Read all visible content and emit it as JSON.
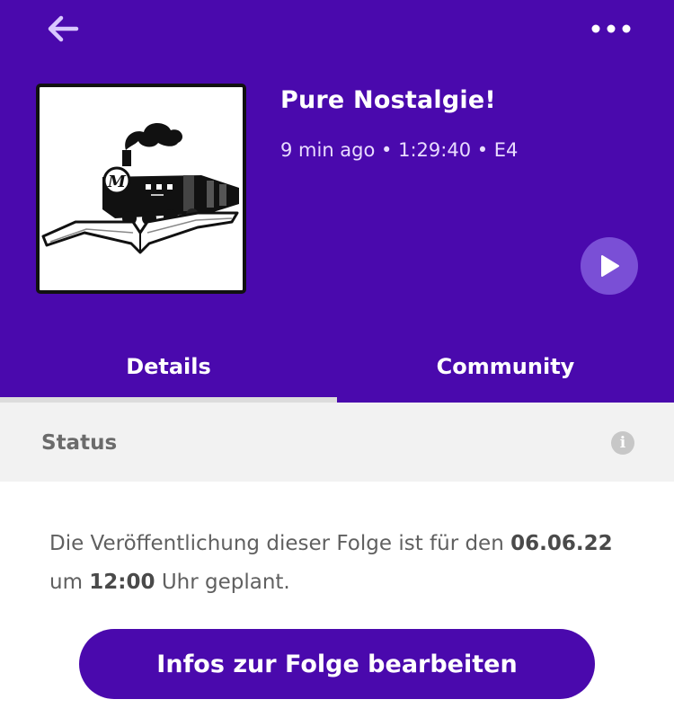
{
  "header": {
    "back_icon": "arrow-left-icon",
    "more_icon": "more-horizontal-icon",
    "background_color": "#4a09ad"
  },
  "episode": {
    "title": "Pure Nostalgie!",
    "meta": "9 min ago • 1:29:40 • E4",
    "cover_logo_letter": "M",
    "cover_icon": "train-on-book-logo",
    "play_icon": "play-icon"
  },
  "tabs": [
    {
      "label": "Details",
      "active": true
    },
    {
      "label": "Community",
      "active": false
    }
  ],
  "status": {
    "label": "Status",
    "info_icon": "info-icon",
    "info_glyph": "i"
  },
  "description": {
    "prefix": "Die Veröffentlichung dieser Folge ist für den",
    "date": "06.06.22",
    "mid": "um",
    "time": "12:00",
    "suffix": "Uhr geplant."
  },
  "actions": {
    "edit_label": "Infos zur Folge bearbeiten"
  }
}
